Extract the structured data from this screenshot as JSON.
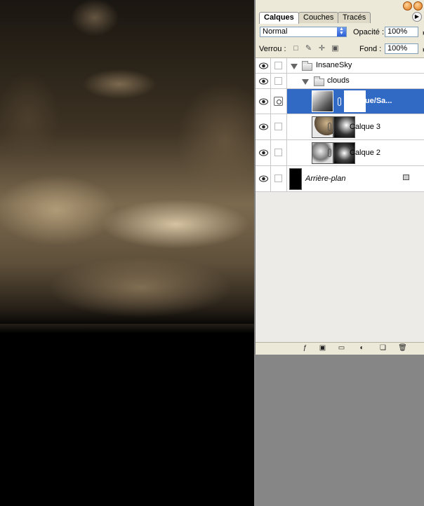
{
  "tabs": [
    {
      "label": "Calques",
      "active": true
    },
    {
      "label": "Couches",
      "active": false
    },
    {
      "label": "Tracés",
      "active": false
    }
  ],
  "blend": {
    "mode": "Normal"
  },
  "opacity": {
    "label": "Opacité :",
    "value": "100%"
  },
  "lock": {
    "label": "Verrou :"
  },
  "fill": {
    "label": "Fond :",
    "value": "100%"
  },
  "layers": [
    {
      "name": "InsaneSky",
      "type": "group",
      "visible": true
    },
    {
      "name": "clouds",
      "type": "group",
      "visible": true
    },
    {
      "name": "Hue/Sa...",
      "type": "adjustment",
      "visible": true,
      "selected": true
    },
    {
      "name": "Calque 3",
      "type": "layer",
      "visible": true
    },
    {
      "name": "Calque 2",
      "type": "layer",
      "visible": true
    },
    {
      "name": "Arrière-plan",
      "type": "background",
      "visible": true,
      "locked": true
    }
  ],
  "colors": {
    "selection": "#316ac5",
    "panel": "#ece9d8",
    "workspace": "#868686"
  },
  "icons": {
    "bottom": [
      "link-layers-icon",
      "layer-style-icon",
      "add-mask-icon",
      "new-group-icon",
      "adjustment-layer-icon",
      "new-layer-icon",
      "trash-icon"
    ]
  }
}
